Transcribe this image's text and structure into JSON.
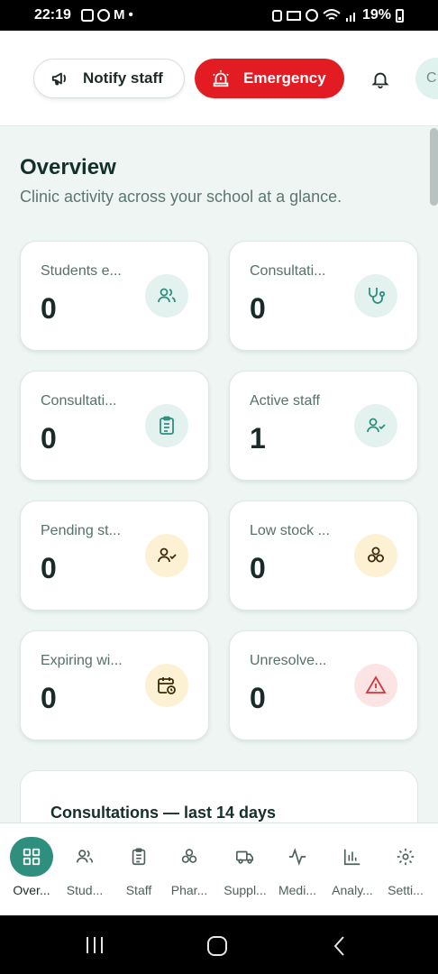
{
  "status_bar": {
    "time": "22:19",
    "carrier_icons": "M",
    "dot": "•",
    "battery": "19%"
  },
  "header": {
    "notify_label": "Notify staff",
    "emergency_label": "Emergency",
    "avatar_initial": "C",
    "emergency_color": "#e31b23"
  },
  "overview": {
    "title": "Overview",
    "subtitle": "Clinic activity across your school at a glance."
  },
  "cards": [
    {
      "label": "Students e...",
      "value": "0",
      "icon": "users-icon",
      "tone": "teal"
    },
    {
      "label": "Consultati...",
      "value": "0",
      "icon": "stethoscope-icon",
      "tone": "teal"
    },
    {
      "label": "Consultati...",
      "value": "0",
      "icon": "clipboard-icon",
      "tone": "teal"
    },
    {
      "label": "Active staff",
      "value": "1",
      "icon": "user-check-icon",
      "tone": "teal"
    },
    {
      "label": "Pending st...",
      "value": "0",
      "icon": "user-check-icon",
      "tone": "amber"
    },
    {
      "label": "Low stock ...",
      "value": "0",
      "icon": "boxes-icon",
      "tone": "amber"
    },
    {
      "label": "Expiring wi...",
      "value": "0",
      "icon": "calendar-clock-icon",
      "tone": "amber"
    },
    {
      "label": "Unresolve...",
      "value": "0",
      "icon": "alert-triangle-icon",
      "tone": "red"
    }
  ],
  "chart_section": {
    "title": "Consultations — last 14 days"
  },
  "bottom_nav": [
    {
      "label": "Over...",
      "icon": "grid-icon",
      "active": true
    },
    {
      "label": "Stud...",
      "icon": "users-icon",
      "active": false
    },
    {
      "label": "Staff",
      "icon": "clipboard-icon",
      "active": false
    },
    {
      "label": "Phar...",
      "icon": "boxes-icon",
      "active": false
    },
    {
      "label": "Suppl...",
      "icon": "truck-icon",
      "active": false
    },
    {
      "label": "Medi...",
      "icon": "activity-icon",
      "active": false
    },
    {
      "label": "Analy...",
      "icon": "bar-chart-icon",
      "active": false
    },
    {
      "label": "Setti...",
      "icon": "gear-icon",
      "active": false
    }
  ],
  "colors": {
    "accent": "#2f8f7e",
    "teal_icon": "#2f8f7e",
    "amber_icon": "#3a2c0a",
    "red_icon": "#d9343b"
  }
}
